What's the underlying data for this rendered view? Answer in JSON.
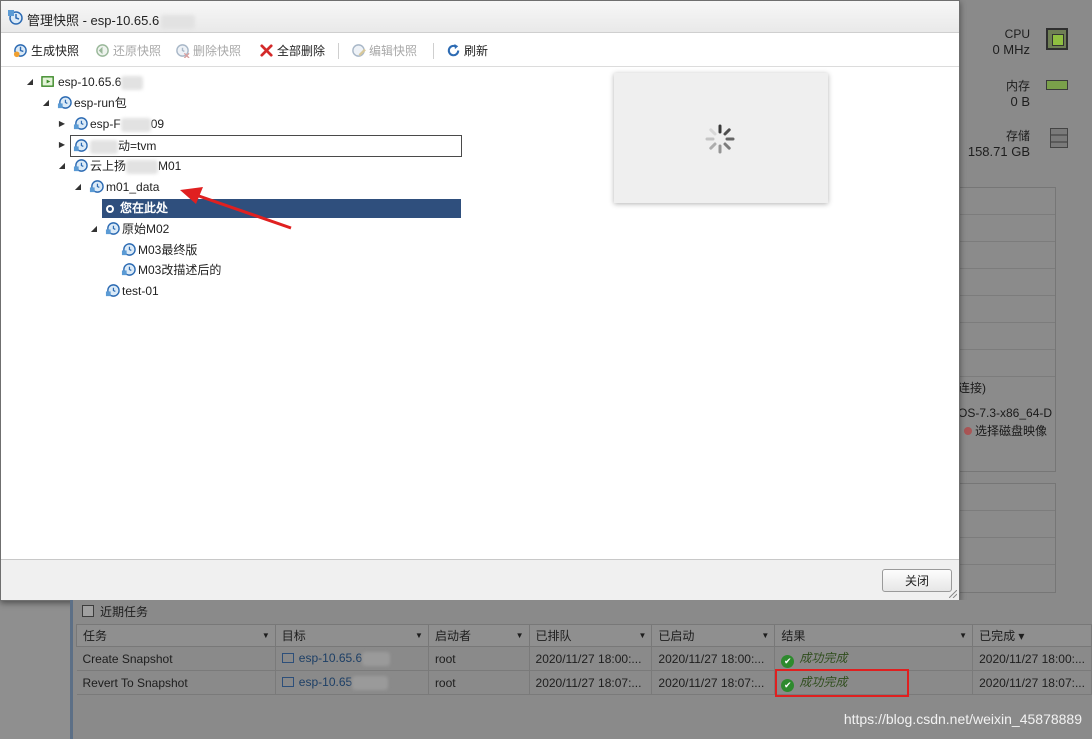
{
  "dialog": {
    "title": "管理快照 - esp-10.65.6",
    "toolbar": {
      "create": "生成快照",
      "revert": "还原快照",
      "delete": "删除快照",
      "delete_all": "全部删除",
      "edit": "编辑快照",
      "refresh": "刷新"
    },
    "tree": {
      "host": "esp-10.65.6",
      "run_pkg": "esp-run包",
      "esp_f": "esp-F",
      "esp_f_suffix": "09",
      "edit_value": "动=tvm",
      "cloud": "云上扬",
      "cloud_suffix": "M01",
      "m01_data": "m01_data",
      "you_are_here": "您在此处",
      "original": "原始M02",
      "m03_final": "M03最终版",
      "m03_changed": "M03改描述后的",
      "test01": "test-01"
    },
    "close_label": "关闭"
  },
  "background": {
    "cpu_label": "CPU",
    "cpu_value": "0 MHz",
    "mem_label": "内存",
    "mem_value": "0 B",
    "storage_label": "存储",
    "storage_value": "158.71 GB",
    "frag1": "连接)",
    "frag2": "OS-7.3-x86_64-D",
    "frag3": "选择磁盘映像"
  },
  "tasks": {
    "title": "近期任务",
    "columns": [
      "任务",
      "目标",
      "启动者",
      "已排队",
      "已启动",
      "结果",
      "已完成 ▾"
    ],
    "rows": [
      {
        "task": "Create Snapshot",
        "target": "esp-10.65.6",
        "initiator": "root",
        "queued": "2020/11/27 18:00:...",
        "started": "2020/11/27 18:00:...",
        "result": "成功完成",
        "completed": "2020/11/27 18:00:..."
      },
      {
        "task": "Revert To Snapshot",
        "target": "esp-10.65",
        "initiator": "root",
        "queued": "2020/11/27 18:07:...",
        "started": "2020/11/27 18:07:...",
        "result": "成功完成",
        "completed": "2020/11/27 18:07:..."
      }
    ]
  },
  "watermark": "https://blog.csdn.net/weixin_45878889",
  "colors": {
    "selection": "#2f4f7d",
    "annotation_red": "#e02020",
    "success_green": "#2e8a2e"
  }
}
